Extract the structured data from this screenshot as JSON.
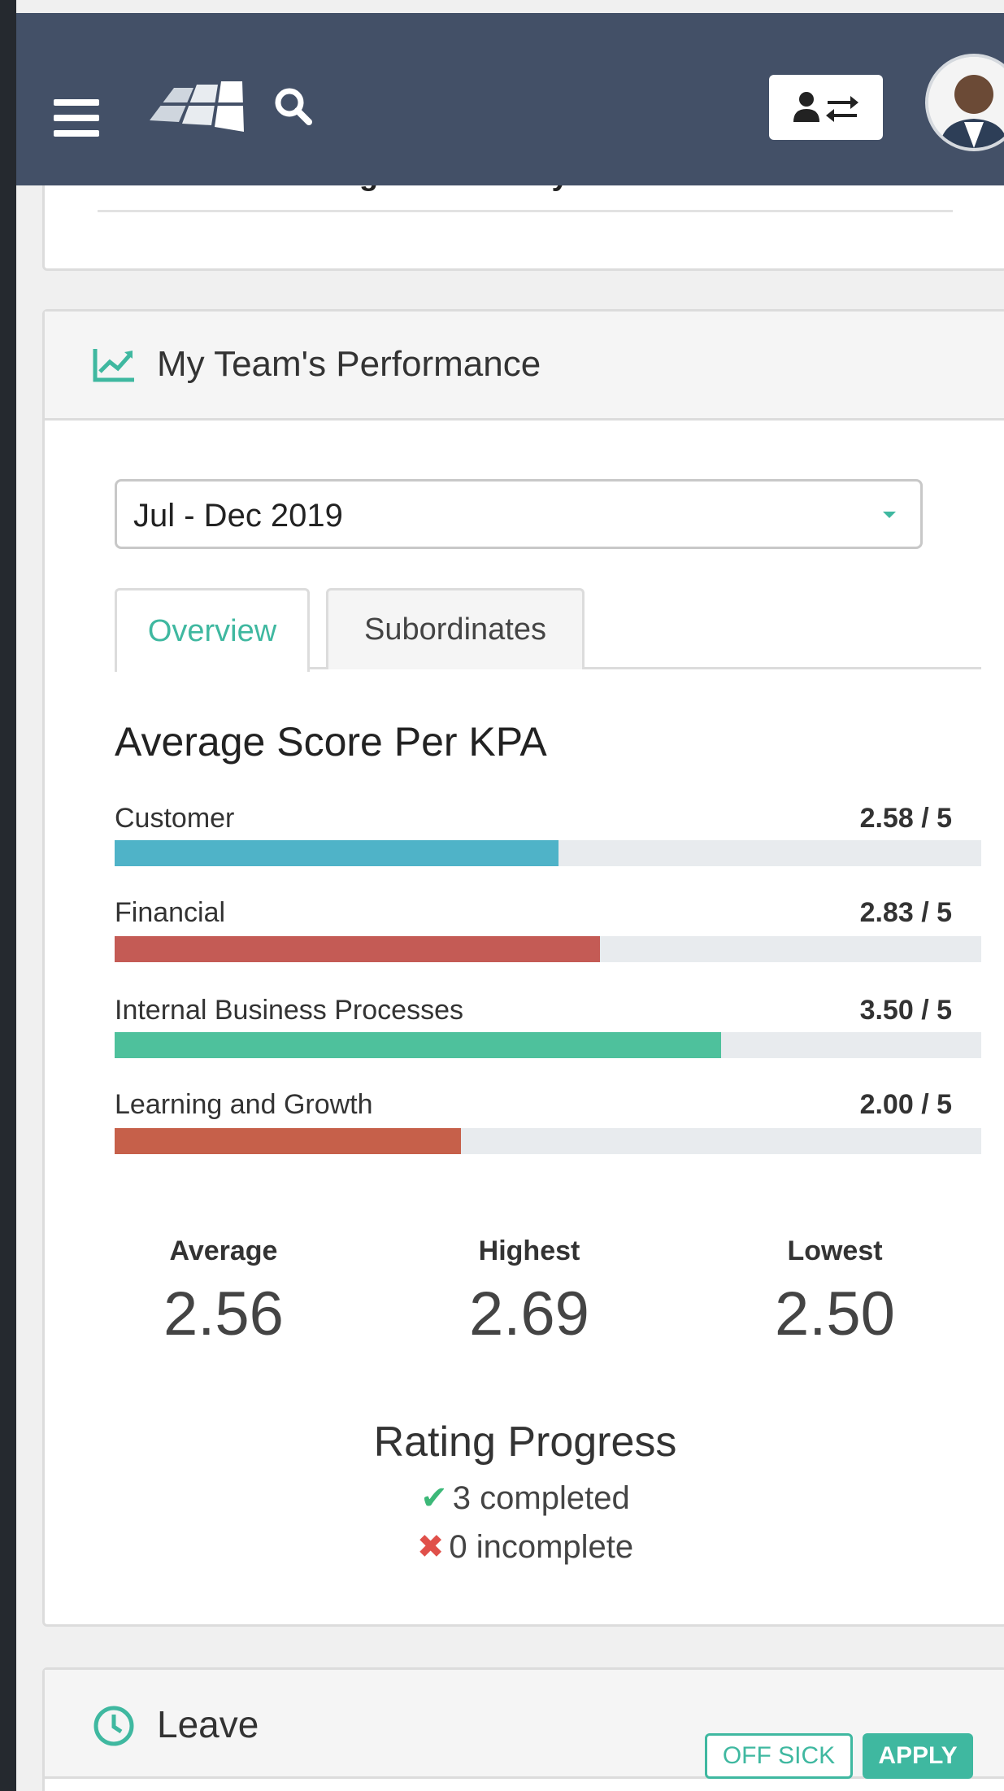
{
  "header": {
    "menu_icon": "hamburger-icon",
    "logo_icon": "app-logo",
    "search_icon": "search-icon",
    "switch_icon": "user-switch-icon",
    "avatar_icon": "user-avatar"
  },
  "previous_card": {
    "item_label": "Performance Management Policy"
  },
  "team_performance": {
    "title": "My Team's Performance",
    "icon": "line-chart-icon",
    "period": "Jul - Dec 2019",
    "tabs": [
      {
        "label": "Overview",
        "active": true
      },
      {
        "label": "Subordinates",
        "active": false
      }
    ],
    "section_title": "Average Score Per KPA",
    "kpas": [
      {
        "label": "Customer",
        "score": "2.58 / 5",
        "fraction": 0.512,
        "color": "#4fb3c8"
      },
      {
        "label": "Financial",
        "score": "2.83 / 5",
        "fraction": 0.56,
        "color": "#c45b55"
      },
      {
        "label": "Internal Business Processes",
        "score": "3.50 / 5",
        "fraction": 0.7,
        "color": "#4ec19c"
      },
      {
        "label": "Learning and Growth",
        "score": "2.00 / 5",
        "fraction": 0.4,
        "color": "#c6604a"
      }
    ],
    "stats": {
      "average_label": "Average",
      "average_value": "2.56",
      "highest_label": "Highest",
      "highest_value": "2.69",
      "lowest_label": "Lowest",
      "lowest_value": "2.50"
    },
    "rating_progress": {
      "title": "Rating Progress",
      "completed": "3 completed",
      "incomplete": "0 incomplete"
    }
  },
  "leave": {
    "title": "Leave",
    "icon": "clock-icon",
    "off_sick_label": "OFF SICK",
    "apply_label": "APPLY"
  },
  "colors": {
    "accent": "#3fb8a0",
    "navbar": "#435067",
    "check": "#3cb878",
    "cross": "#e0504a"
  }
}
